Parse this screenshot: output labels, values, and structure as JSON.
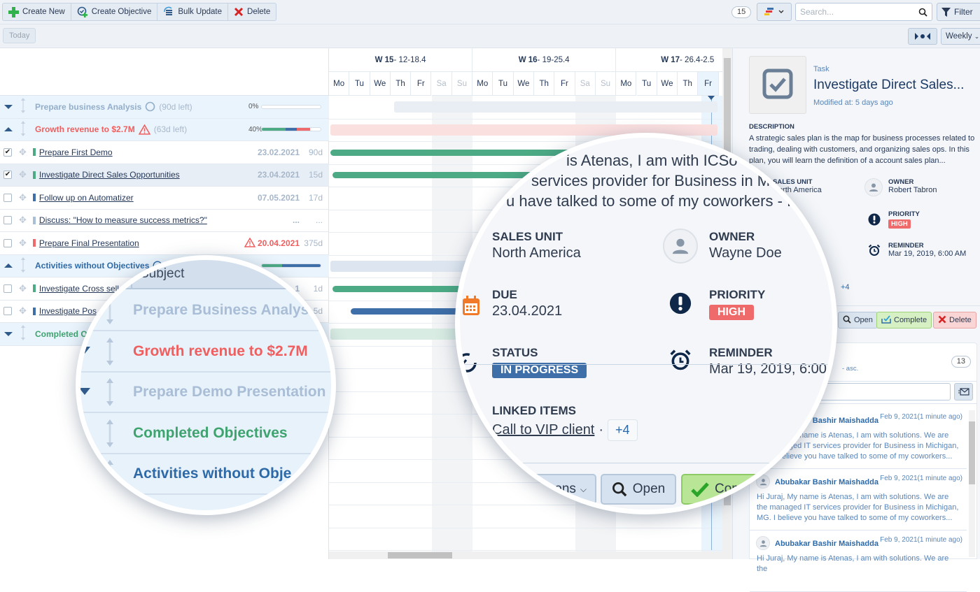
{
  "toolbar": {
    "buttons": [
      {
        "label": "Create New",
        "icon": "plus-icon"
      },
      {
        "label": "Create Objective",
        "icon": "create-objective-icon"
      },
      {
        "label": "Bulk Update",
        "icon": "bulk-update-icon"
      },
      {
        "label": "Delete",
        "icon": "delete-x-icon"
      }
    ],
    "count": "15",
    "search_placeholder": "Search...",
    "filter_label": "Filter"
  },
  "subbar": {
    "today_label": "Today",
    "view_mode": "Weekly"
  },
  "colors": {
    "green": "#4caa85",
    "blue": "#3f6fa8",
    "red": "#ef6a6a",
    "light_blue": "#a9bfd8",
    "accent": "#2f6aa8"
  },
  "rows": [
    {
      "type": "group",
      "title": "Prepare business Analysis",
      "status_icon": "circle-icon",
      "extra": "(90d left)",
      "pct": "0%",
      "progress": {
        "green": 0,
        "blue": 0,
        "red": 0
      },
      "color": "#93aecb",
      "expanded": false
    },
    {
      "type": "group",
      "title": "Growth revenue to $2.7M",
      "status_icon": "warning-icon",
      "extra": "(63d left)",
      "pct": "40%",
      "progress": {
        "green": 40,
        "blue": 20,
        "red": 22
      },
      "color": "#ef5f5f",
      "expanded": true
    },
    {
      "type": "task",
      "checked": true,
      "name": "Prepare First Demo",
      "date": "23.02.2021",
      "dur": "90d",
      "bar_color": "#4caa85"
    },
    {
      "type": "task",
      "checked": true,
      "selected": true,
      "name": "Investigate Direct Sales Opportunities",
      "date": "23.04.2021",
      "dur": "15d",
      "bar_color": "#4caa85"
    },
    {
      "type": "task",
      "checked": false,
      "name": "Follow up on Automatizer",
      "date": "07.05.2021",
      "dur": "17d",
      "bar_color": "#3f6fa8"
    },
    {
      "type": "task",
      "checked": false,
      "name": "Discuss: \"How to measure success metrics?\"",
      "date": "...",
      "dur": "...",
      "bar_color": "#a9bfd8"
    },
    {
      "type": "task",
      "checked": false,
      "name": "Prepare Final Presentation",
      "date": "20.04.2021",
      "dur": "375d",
      "bar_color": "#ef6a6a",
      "overdue": true
    },
    {
      "type": "group",
      "title": "Activities without Objectives",
      "status_icon": "clock-icon",
      "extra": "",
      "pct": "",
      "progress": {
        "green": 35,
        "blue": 65,
        "red": 0
      },
      "color": "#2f6aa8",
      "expanded": true
    },
    {
      "type": "task",
      "checked": false,
      "name": "Investigate Cross sell",
      "date": "1",
      "dur": "1d",
      "bar_color": "#4caa85"
    },
    {
      "type": "task",
      "checked": false,
      "name": "Investigate Pos",
      "date": "",
      "dur": "5d",
      "bar_color": "#3f6fa8"
    },
    {
      "type": "group",
      "title": "Completed Objectives",
      "status_icon": "check-circle-icon",
      "extra": "",
      "pct": "",
      "progress": null,
      "color": "#3fa36f",
      "expanded": false
    }
  ],
  "gantt": {
    "weeks": [
      {
        "label": "W 15",
        "range": " - 12-18.4"
      },
      {
        "label": "W 16",
        "range": " - 19-25.4"
      },
      {
        "label": "W 17",
        "range": " - 26.4-2.5"
      }
    ],
    "days": [
      "Mo",
      "Tu",
      "We",
      "Th",
      "Fr",
      "Sa",
      "Su",
      "Mo",
      "Tu",
      "We",
      "Th",
      "Fr",
      "Sa",
      "Su",
      "Mo",
      "Tu",
      "We",
      "Th",
      "Fr"
    ],
    "today_index": 18
  },
  "detail": {
    "type": "Task",
    "title": "Investigate Direct Sales...",
    "modified": "Modified at: 5 days ago",
    "description_label": "DESCRIPTION",
    "description": "A strategic sales plan is the map for business processes related to trading, dealing with customers, and organizing sales ops. In this plan, you will learn the definition of a account sales plan...",
    "sales_unit_label": "SALES UNIT",
    "sales_unit": "North America",
    "owner_label": "OWNER",
    "owner": "Robert Tabron",
    "priority_label": "PRIORITY",
    "priority": "HIGH",
    "reminder_label": "REMINDER",
    "reminder": "Mar 19, 2019, 6:00 AM",
    "linked_more": "+4",
    "buttons": {
      "open": "Open",
      "complete": "Complete",
      "delete": "Delete"
    }
  },
  "messages": {
    "count": "13",
    "sort_label": "- asc.",
    "items": [
      {
        "author": "Abubakar Bashir Maishadda",
        "time": "Feb 9, 2021(1 minute ago)",
        "body": "Hi Juraj, My name is Atenas, I am with solutions. We are the managed IT services provider for Business in Michigan, MG. I believe you have talked to some of my coworkers..."
      },
      {
        "author": "Abubakar Bashir Maishadda",
        "time": "Feb 9, 2021(1 minute ago)",
        "body": "Hi Juraj, My name is Atenas, I am with solutions. We are the managed IT services provider for Business in Michigan, MG. I believe you have talked to some of my coworkers..."
      },
      {
        "author": "Abubakar Bashir Maishadda",
        "time": "Feb 9, 2021(1 minute ago)",
        "body": "Hi Juraj, My name is Atenas, I am with solutions. We are the"
      }
    ]
  },
  "lens_left": {
    "header": "Subject",
    "rows": [
      {
        "title": "Prepare Business Analysis",
        "color": "#a9bed6"
      },
      {
        "title": "Growth revenue to $2.7M",
        "color": "#ef5f5f"
      },
      {
        "title": "Prepare Demo Presentation",
        "color": "#a9bed6"
      },
      {
        "title": "Completed Objectives",
        "color": "#3fa36f"
      },
      {
        "title": "Activities without Obje",
        "color": "#2f6aa8"
      }
    ]
  },
  "lens_right": {
    "snippet": [
      "is Atenas, I am with ICSo",
      "services provider for Business in Mi",
      "u have talked to some of my coworkers - I"
    ],
    "sales_unit_label": "SALES UNIT",
    "sales_unit": "North America",
    "owner_label": "OWNER",
    "owner": "Wayne Doe",
    "due_label": "DUE",
    "due": "23.04.2021",
    "priority_label": "PRIORITY",
    "priority": "HIGH",
    "status_label": "STATUS",
    "status": "IN PROGRESS",
    "reminder_label": "REMINDER",
    "reminder": "Mar 19, 2019, 6:00",
    "linked_label": "LINKED ITEMS",
    "linked_item": "Call to VIP client",
    "linked_more": "+4",
    "actions_label": "ons",
    "open_label": "Open",
    "complete_label": "Com"
  }
}
